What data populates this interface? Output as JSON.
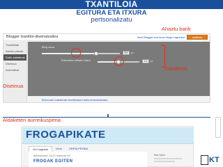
{
  "slide": {
    "title": "TXANTILOIA",
    "subtitle_line1": "EGITURA ETA ITXURA",
    "subtitle_line2": "pertsonalizatu"
  },
  "annotations": {
    "save_note": "Ahaztu barik",
    "width_note": "Zabalerak",
    "layout_note": "Diseinua",
    "preview_note": "Aldaketen aurreikuspena"
  },
  "blogger": {
    "window_title": "Blogger txantiloi-diseinatzailea",
    "links": "Itzuli Blogger-era  Ikusi bloga  Laguntza",
    "save_button": "Aplikatu bloguari",
    "sidebar_items": [
      {
        "label": "Txantiloiak",
        "active": false
      },
      {
        "label": "Atzeko planoa",
        "active": false
      },
      {
        "label": "Doitu zabalerak",
        "active": true
      },
      {
        "label": "Diseinua",
        "active": false
      },
      {
        "label": "Aurreratua",
        "active": false
      }
    ],
    "width_controls": {
      "blog_label": "Blog osoa",
      "sidebar_label": "Eskuineko alboko barra",
      "blog_value": "960",
      "sidebar_value": "310",
      "blog_level": 0.7,
      "sidebar_level": 0.5,
      "unit": "px"
    },
    "reset_link": "Berrezarri zabalerak txantiloiaren balio lehenetsietara"
  },
  "preview": {
    "site_title": "FROGAPIKATE",
    "tabs": [
      {
        "label": "Orri nagusia",
        "active": true
      },
      {
        "label": "Orria",
        "active": false
      },
      {
        "label": "ORRIA PROBA",
        "active": false
      }
    ],
    "post_date": "asteazkena, 2013 martxoa 06",
    "post_title": "FROGAK EGITEN",
    "aside_heading": "Nor bera"
  },
  "logo": {
    "text": "KT"
  },
  "colors": {
    "accent": "#1a4f9c",
    "annotation": "#e0301e",
    "save_button": "#e07b1a"
  }
}
